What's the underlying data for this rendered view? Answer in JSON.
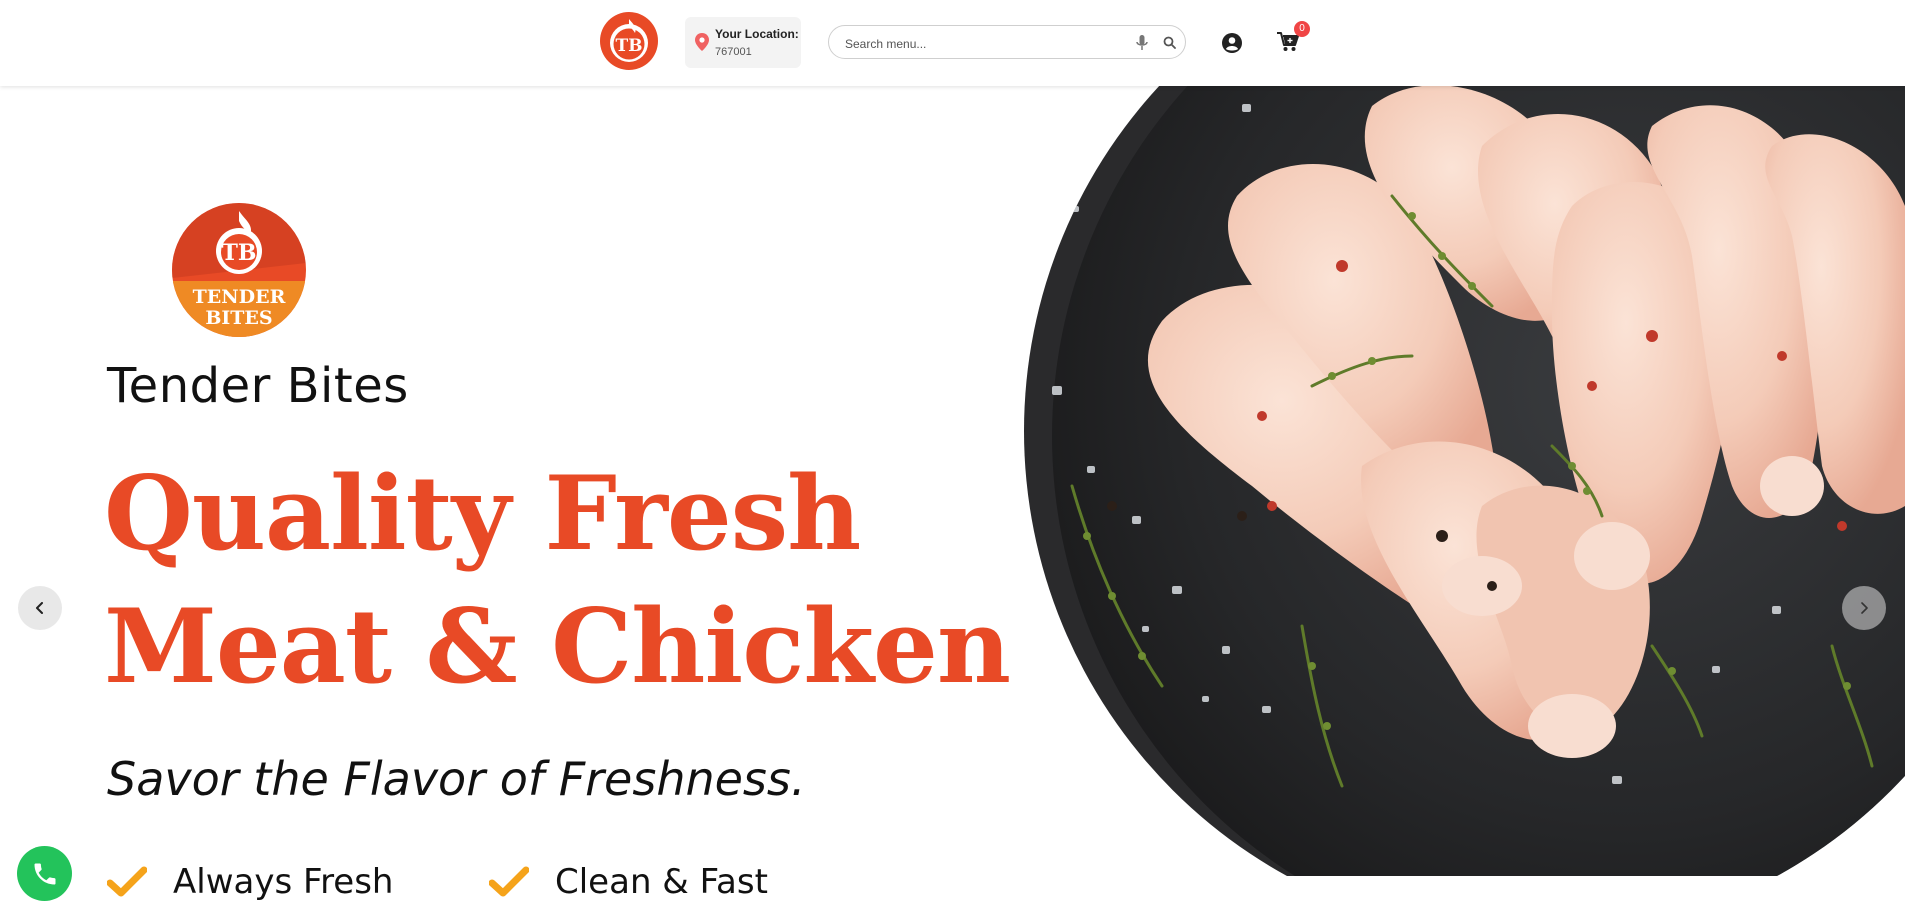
{
  "header": {
    "logo_initials": "TB",
    "location_label": "Your Location:",
    "location_value": "767001",
    "search_placeholder": "Search menu...",
    "cart_count": "0",
    "icons": [
      "location-pin-icon",
      "microphone-icon",
      "search-icon",
      "user-icon",
      "cart-icon"
    ]
  },
  "hero": {
    "badge_line1": "TENDER",
    "badge_line2": "BITES",
    "brand_name": "Tender Bites",
    "headline_line1": "Quality Fresh",
    "headline_line2": "Meat & Chicken",
    "tagline": "Savor the Flavor of Freshness.",
    "features": [
      "Always Fresh",
      "Clean & Fast"
    ],
    "image_subject": "raw chicken drumsticks on dark slate plate with herbs"
  },
  "carousel": {
    "prev_icon": "chevron-left-icon",
    "next_icon": "chevron-right-icon"
  },
  "floating": {
    "call_icon": "phone-icon"
  },
  "colors": {
    "brand_red": "#e84a26",
    "brand_orange": "#ef8a24",
    "check_orange": "#f5a31a",
    "call_green": "#23c35b",
    "badge_red": "#f04545"
  }
}
